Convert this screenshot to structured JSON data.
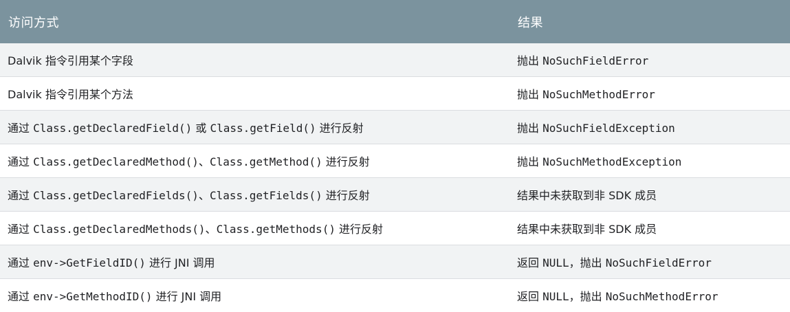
{
  "header": {
    "col1": "访问方式",
    "col2": "结果"
  },
  "rows": [
    {
      "method": [
        {
          "t": "Dalvik 指令引用某个字段"
        }
      ],
      "result": [
        {
          "t": "抛出 "
        },
        {
          "t": "NoSuchFieldError",
          "code": true
        }
      ]
    },
    {
      "method": [
        {
          "t": "Dalvik 指令引用某个方法"
        }
      ],
      "result": [
        {
          "t": "抛出 "
        },
        {
          "t": "NoSuchMethodError",
          "code": true
        }
      ]
    },
    {
      "method": [
        {
          "t": "通过 "
        },
        {
          "t": "Class.getDeclaredField()",
          "code": true
        },
        {
          "t": " 或 "
        },
        {
          "t": "Class.getField()",
          "code": true
        },
        {
          "t": " 进行反射"
        }
      ],
      "result": [
        {
          "t": "抛出 "
        },
        {
          "t": "NoSuchFieldException",
          "code": true
        }
      ]
    },
    {
      "method": [
        {
          "t": "通过 "
        },
        {
          "t": "Class.getDeclaredMethod()",
          "code": true
        },
        {
          "t": "、"
        },
        {
          "t": "Class.getMethod()",
          "code": true
        },
        {
          "t": " 进行反射"
        }
      ],
      "result": [
        {
          "t": "抛出 "
        },
        {
          "t": "NoSuchMethodException",
          "code": true
        }
      ]
    },
    {
      "method": [
        {
          "t": "通过 "
        },
        {
          "t": "Class.getDeclaredFields()",
          "code": true
        },
        {
          "t": "、"
        },
        {
          "t": "Class.getFields()",
          "code": true
        },
        {
          "t": " 进行反射"
        }
      ],
      "result": [
        {
          "t": "结果中未获取到非 SDK 成员"
        }
      ]
    },
    {
      "method": [
        {
          "t": "通过 "
        },
        {
          "t": "Class.getDeclaredMethods()",
          "code": true
        },
        {
          "t": "、"
        },
        {
          "t": "Class.getMethods()",
          "code": true
        },
        {
          "t": " 进行反射"
        }
      ],
      "result": [
        {
          "t": "结果中未获取到非 SDK 成员"
        }
      ]
    },
    {
      "method": [
        {
          "t": "通过 "
        },
        {
          "t": "env->GetFieldID()",
          "code": true
        },
        {
          "t": " 进行 JNI 调用"
        }
      ],
      "result": [
        {
          "t": "返回 "
        },
        {
          "t": "NULL",
          "code": true
        },
        {
          "t": "，抛出 "
        },
        {
          "t": "NoSuchFieldError",
          "code": true
        }
      ]
    },
    {
      "method": [
        {
          "t": "通过 "
        },
        {
          "t": "env->GetMethodID()",
          "code": true
        },
        {
          "t": " 进行 JNI 调用"
        }
      ],
      "result": [
        {
          "t": "返回 "
        },
        {
          "t": "NULL",
          "code": true
        },
        {
          "t": "，抛出 "
        },
        {
          "t": "NoSuchMethodError",
          "code": true
        }
      ]
    }
  ]
}
